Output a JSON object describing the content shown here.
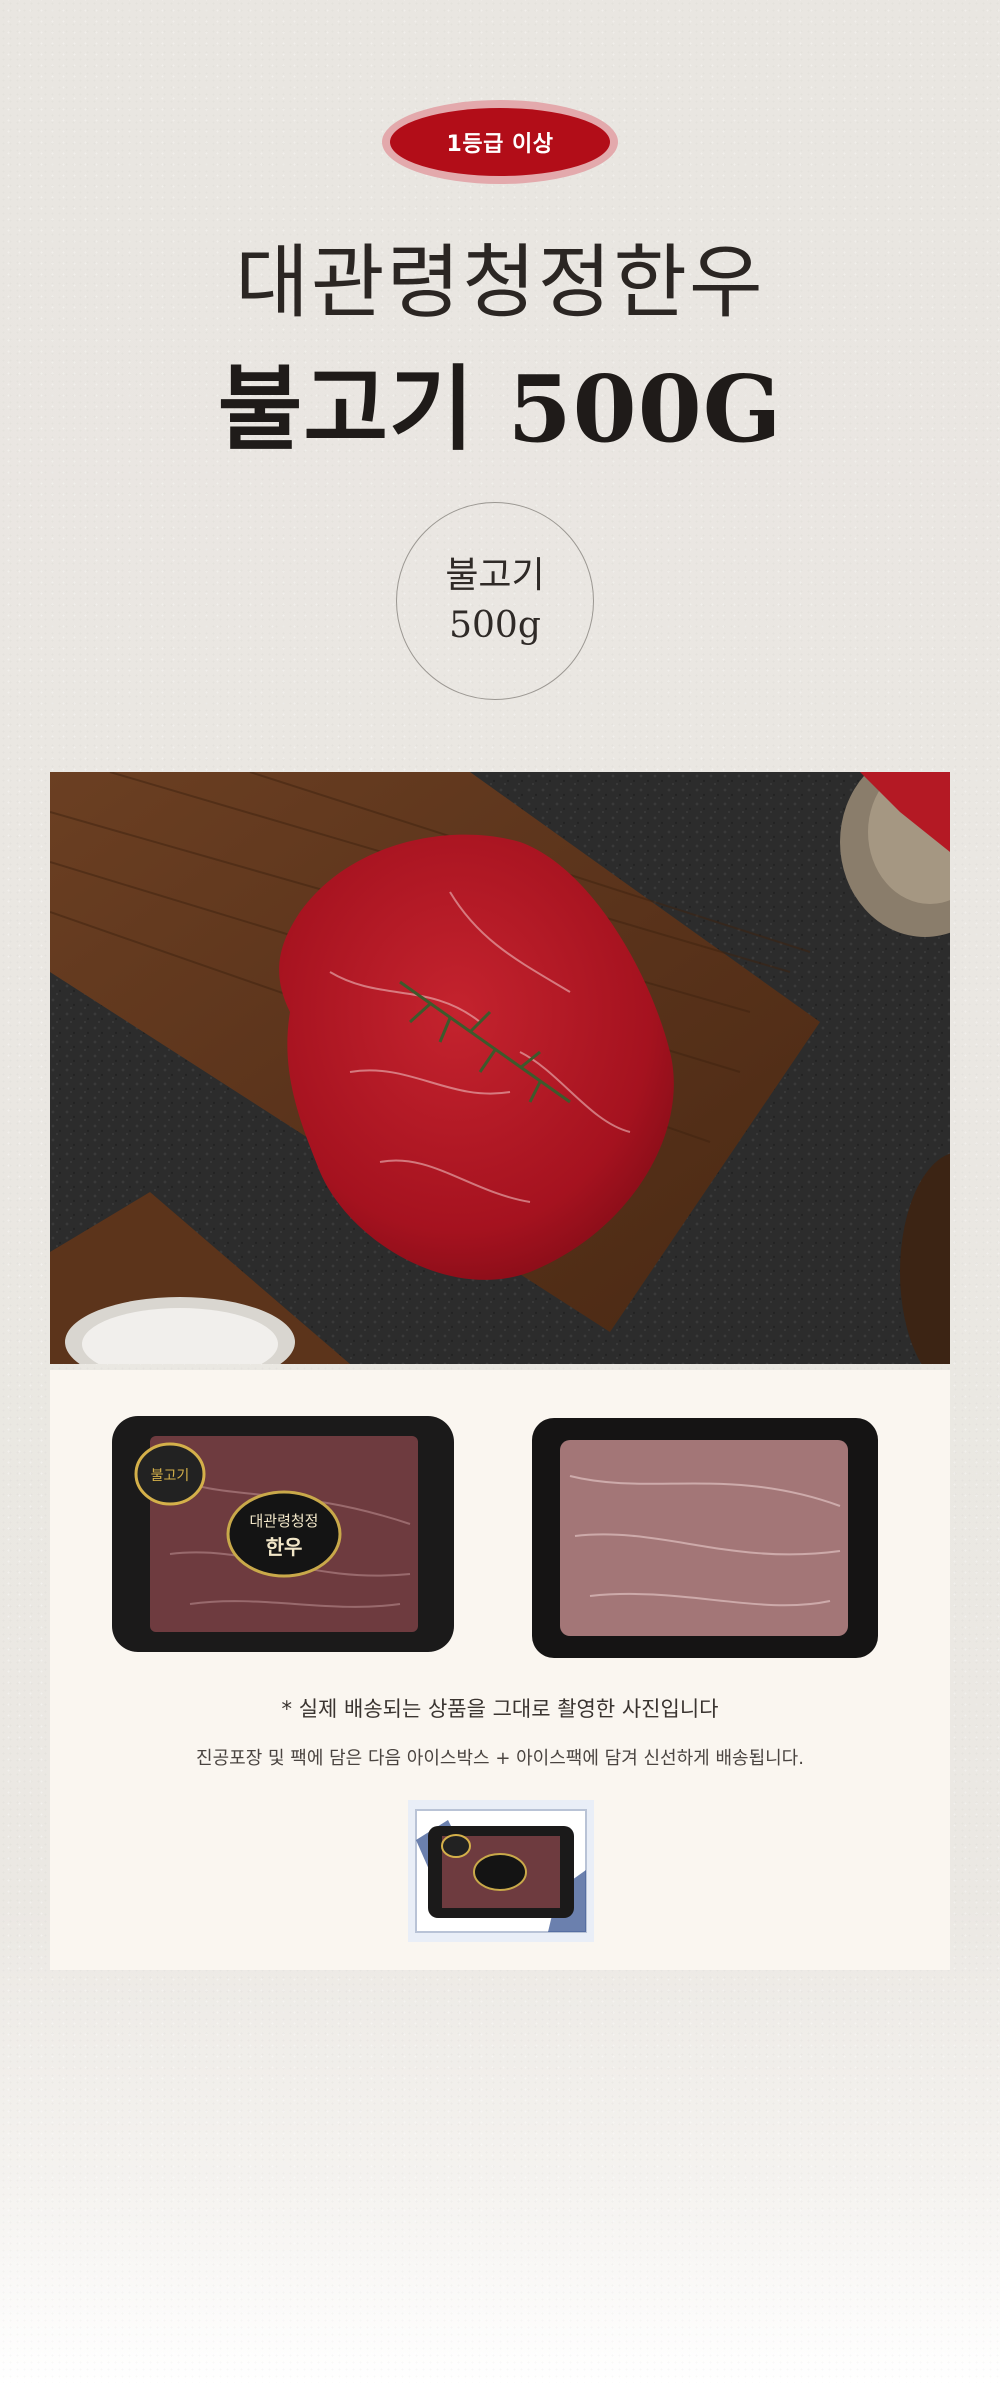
{
  "badge": {
    "label": "1등급 이상"
  },
  "title": {
    "line1": "대관령청정한우",
    "line2": "불고기 500G"
  },
  "circle": {
    "name": "불고기",
    "weight": "500g"
  },
  "package": {
    "sticker_brand": "대관령청정",
    "sticker_brand2": "한우",
    "sticker_tag": "불고기",
    "note": "* 실제 배송되는 상품을 그대로 촬영한 사진입니다",
    "shipping": "진공포장 및 팩에 담은 다음 아이스박스 + 아이스팩에 담겨 신선하게 배송됩니다."
  },
  "colors": {
    "badge_red": "#b20d18",
    "badge_ring": "#e3a9ac",
    "cream": "#faf6f0"
  }
}
